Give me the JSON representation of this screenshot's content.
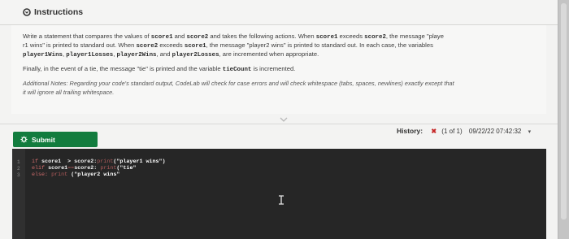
{
  "header": {
    "title": "Instructions",
    "icon": "circle-chevron-icon"
  },
  "instructions": {
    "p1": [
      {
        "t": "Write a statement that compares the values of ",
        "code": false
      },
      {
        "t": "score1",
        "code": true
      },
      {
        "t": " and ",
        "code": false
      },
      {
        "t": "score2",
        "code": true
      },
      {
        "t": " and takes the following actions. When ",
        "code": false
      },
      {
        "t": "score1",
        "code": true
      },
      {
        "t": " exceeds ",
        "code": false
      },
      {
        "t": "score2",
        "code": true
      },
      {
        "t": ", the message \"playe",
        "code": false
      }
    ],
    "p2": [
      {
        "t": "r1 wins\" is printed to standard out. When ",
        "code": false
      },
      {
        "t": "score2",
        "code": true
      },
      {
        "t": " exceeds ",
        "code": false
      },
      {
        "t": "score1",
        "code": true
      },
      {
        "t": ", the message \"player2 wins\" is printed to standard out. In each case, the variables",
        "code": false
      }
    ],
    "p3": [
      {
        "t": "player1Wins",
        "code": true
      },
      {
        "t": ", ",
        "code": false
      },
      {
        "t": "player1Losses",
        "code": true
      },
      {
        "t": ", ",
        "code": false
      },
      {
        "t": "player2Wins",
        "code": true
      },
      {
        "t": ", and ",
        "code": false
      },
      {
        "t": "player2Losses",
        "code": true
      },
      {
        "t": ", are incremented when appropriate.",
        "code": false
      }
    ],
    "p4": [
      {
        "t": "Finally, in the event of a tie, the message \"tie\" is printed and the variable ",
        "code": false
      },
      {
        "t": "tieCount",
        "code": true
      },
      {
        "t": " is incremented.",
        "code": false
      }
    ],
    "note1": "Additional Notes: Regarding your code's standard output, CodeLab will check for case errors and will check whitespace (tabs, spaces, newlines) exactly except that",
    "note2": "it will ignore all trailing whitespace."
  },
  "submit": {
    "label": "Submit",
    "color": "#127c3e"
  },
  "history": {
    "label": "History:",
    "status_icon": "x-mark-icon",
    "count": "(1 of 1)",
    "timestamp": "09/22/22  07:42:32",
    "dropdown_icon": "chevron-down-icon"
  },
  "editor": {
    "line_numbers": [
      "1",
      "2",
      "3"
    ],
    "lines": [
      [
        {
          "t": "if ",
          "k": "kw"
        },
        {
          "t": "score1  > score2:",
          "k": "plain"
        },
        {
          "t": "print",
          "k": "fn"
        },
        {
          "t": "(\"player1 wins\")",
          "k": "str"
        }
      ],
      [
        {
          "t": "elif ",
          "k": "kw"
        },
        {
          "t": "score1",
          "k": "plain"
        },
        {
          "t": "==",
          "k": "fn"
        },
        {
          "t": "score2: ",
          "k": "plain"
        },
        {
          "t": "print",
          "k": "fn"
        },
        {
          "t": "(\"tie\"",
          "k": "str"
        }
      ],
      [
        {
          "t": "else: ",
          "k": "kw"
        },
        {
          "t": "print ",
          "k": "fn"
        },
        {
          "t": "(\"player2 wins\"",
          "k": "str"
        }
      ]
    ]
  }
}
